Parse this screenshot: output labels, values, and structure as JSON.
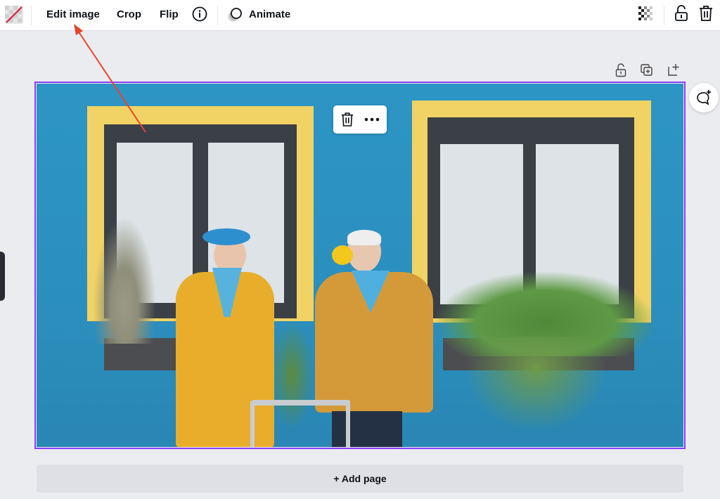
{
  "toolbar": {
    "edit_image": "Edit image",
    "crop": "Crop",
    "flip": "Flip",
    "animate": "Animate"
  },
  "page_actions": [
    "lock-icon",
    "duplicate-page-icon",
    "add-page-icon"
  ],
  "canvas": {
    "selection_color": "#8b3dff",
    "add_page_label": "+ Add page"
  },
  "annotation": {
    "arrow_color": "#e8432d"
  }
}
